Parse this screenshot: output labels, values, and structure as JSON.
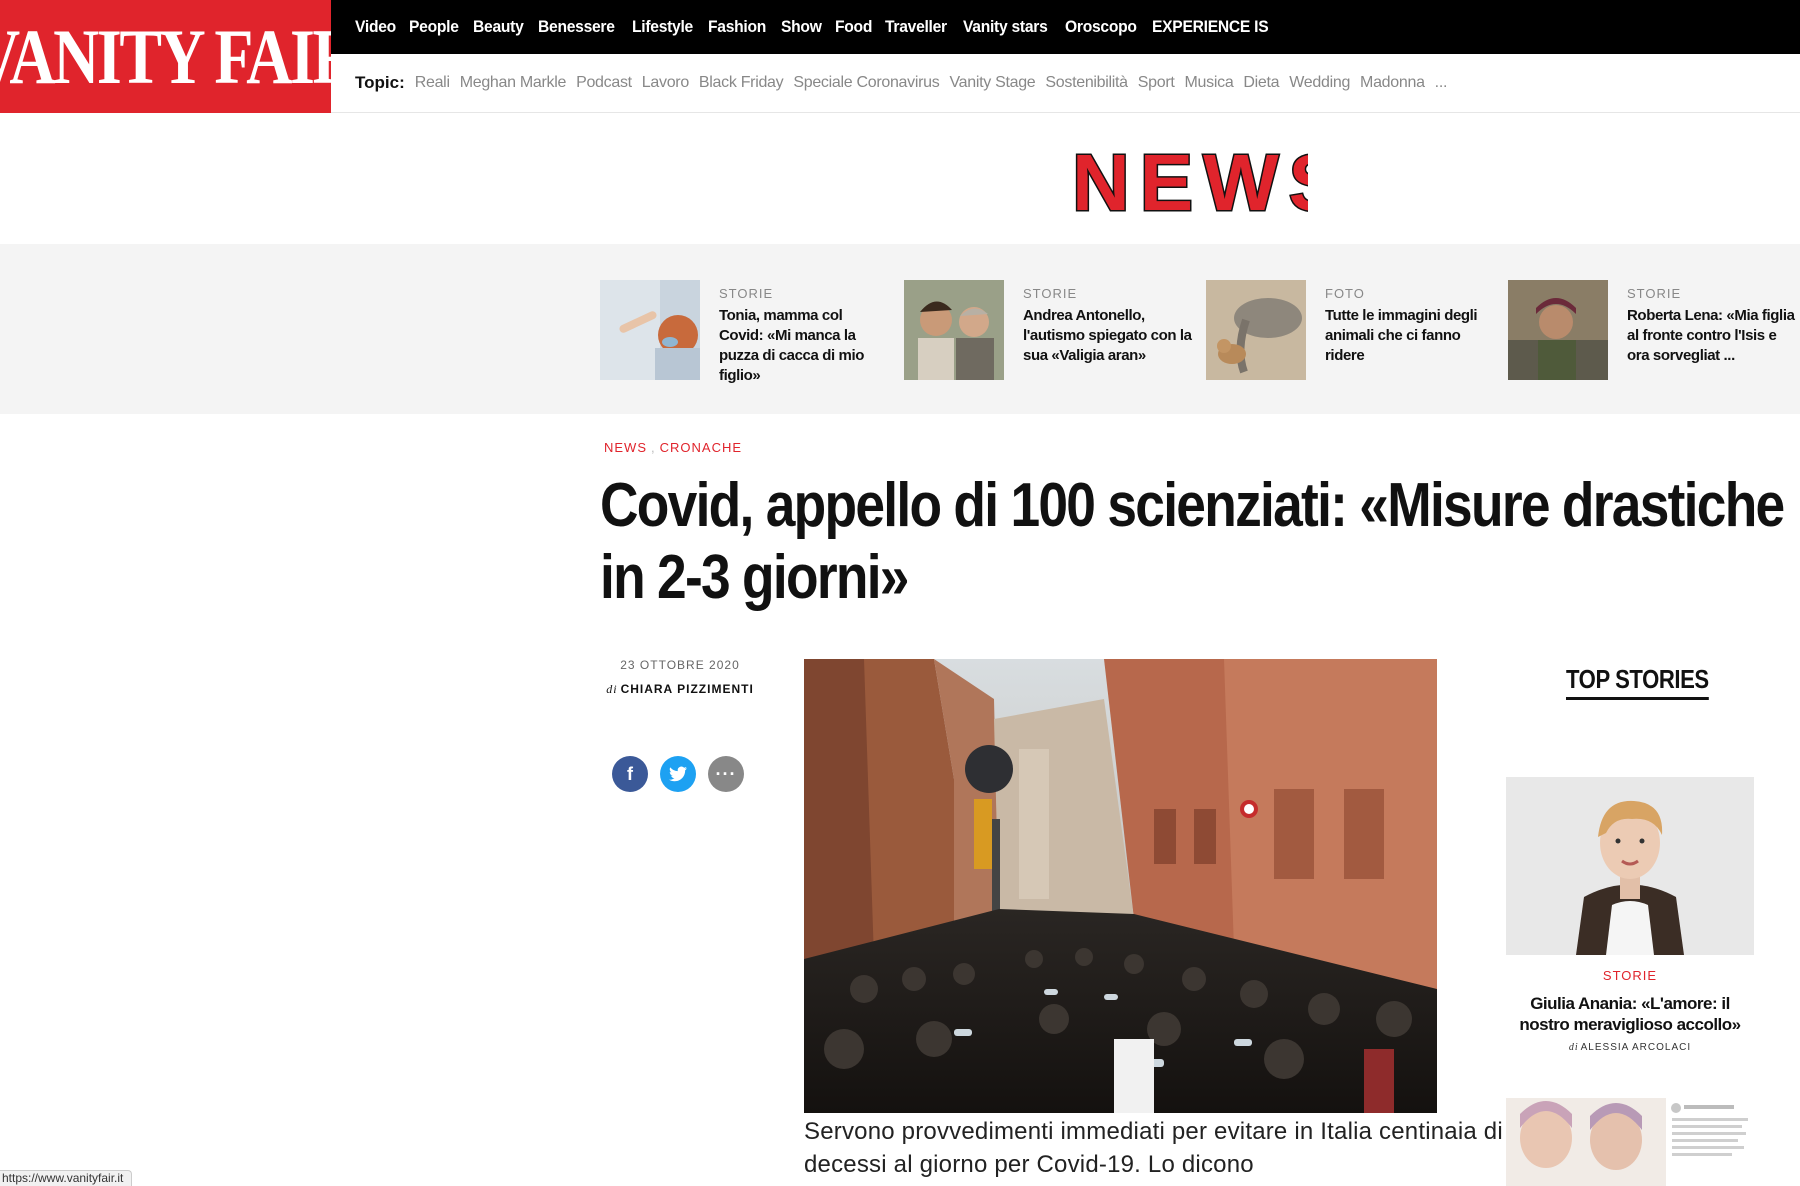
{
  "brand": {
    "logo_text": "VANITY FAIR",
    "accent": "#e0242c"
  },
  "nav": {
    "items": [
      "Video",
      "People",
      "Beauty",
      "Benessere",
      "Lifestyle",
      "Fashion",
      "Show",
      "Food",
      "Traveller",
      "Vanity stars",
      "Oroscopo",
      "EXPERIENCE IS"
    ]
  },
  "topics": {
    "label": "Topic:",
    "items": [
      "Reali",
      "Meghan Markle",
      "Podcast",
      "Lavoro",
      "Black Friday",
      "Speciale Coronavirus",
      "Vanity Stage",
      "Sostenibilità",
      "Sport",
      "Musica",
      "Dieta",
      "Wedding",
      "Madonna",
      "..."
    ]
  },
  "section_banner": "NEWS",
  "related": [
    {
      "category": "STORIE",
      "title": "Tonia, mamma col Covid: «Mi manca la puzza di cacca di mio figlio»"
    },
    {
      "category": "STORIE",
      "title": "Andrea Antonello, l'autismo spiegato con la sua «Valigia aran»"
    },
    {
      "category": "FOTO",
      "title": "Tutte le immagini degli animali che ci fanno ridere"
    },
    {
      "category": "STORIE",
      "title": "Roberta Lena: «Mia figlia al fronte contro l'Isis e ora sorvegliat ..."
    }
  ],
  "article": {
    "breadcrumb": [
      "NEWS",
      "CRONACHE"
    ],
    "breadcrumb_sep": ",",
    "headline": "Covid, appello di 100 scienziati: «Misure drastiche in 2-3 giorni»",
    "date": "23 OTTOBRE 2020",
    "byline_prefix": "di",
    "author": "CHIARA PIZZIMENTI",
    "summary": "Servono provvedimenti immediati per evitare in Italia centinaia di decessi al giorno per Covid-19. Lo dicono"
  },
  "share": {
    "facebook": "f",
    "more": "···"
  },
  "sidebar": {
    "heading": "TOP STORIES",
    "story": {
      "category": "STORIE",
      "title": "Giulia Anania: «L'amore: il nostro meraviglioso accollo»",
      "byline_prefix": "di",
      "author": "ALESSIA ARCOLACI"
    }
  },
  "status_bar": {
    "url": "https://www.vanityfair.it"
  }
}
